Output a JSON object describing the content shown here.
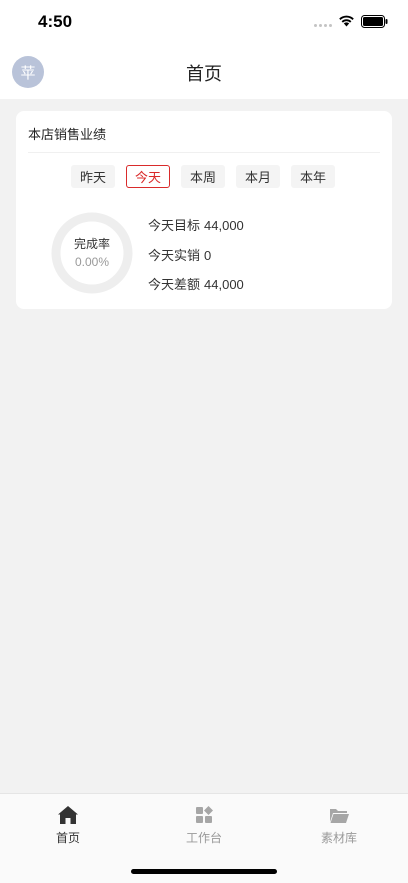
{
  "status_bar": {
    "time": "4:50"
  },
  "nav": {
    "avatar_text": "苹",
    "title": "首页"
  },
  "card": {
    "title": "本店销售业绩",
    "tabs": [
      {
        "label": "昨天",
        "active": false
      },
      {
        "label": "今天",
        "active": true
      },
      {
        "label": "本周",
        "active": false
      },
      {
        "label": "本月",
        "active": false
      },
      {
        "label": "本年",
        "active": false
      }
    ],
    "completion": {
      "label": "完成率",
      "value": "0.00%",
      "fraction": 0
    },
    "stats": [
      {
        "label": "今天目标",
        "value": "44,000"
      },
      {
        "label": "今天实销",
        "value": "0"
      },
      {
        "label": "今天差额",
        "value": "44,000"
      }
    ]
  },
  "tab_bar": {
    "items": [
      {
        "label": "首页",
        "icon": "home-icon",
        "active": true
      },
      {
        "label": "工作台",
        "icon": "workbench-icon",
        "active": false
      },
      {
        "label": "素材库",
        "icon": "folder-icon",
        "active": false
      }
    ]
  },
  "colors": {
    "accent": "#d92b2b",
    "background": "#f2f2f2",
    "avatar": "#b9c3d9"
  }
}
